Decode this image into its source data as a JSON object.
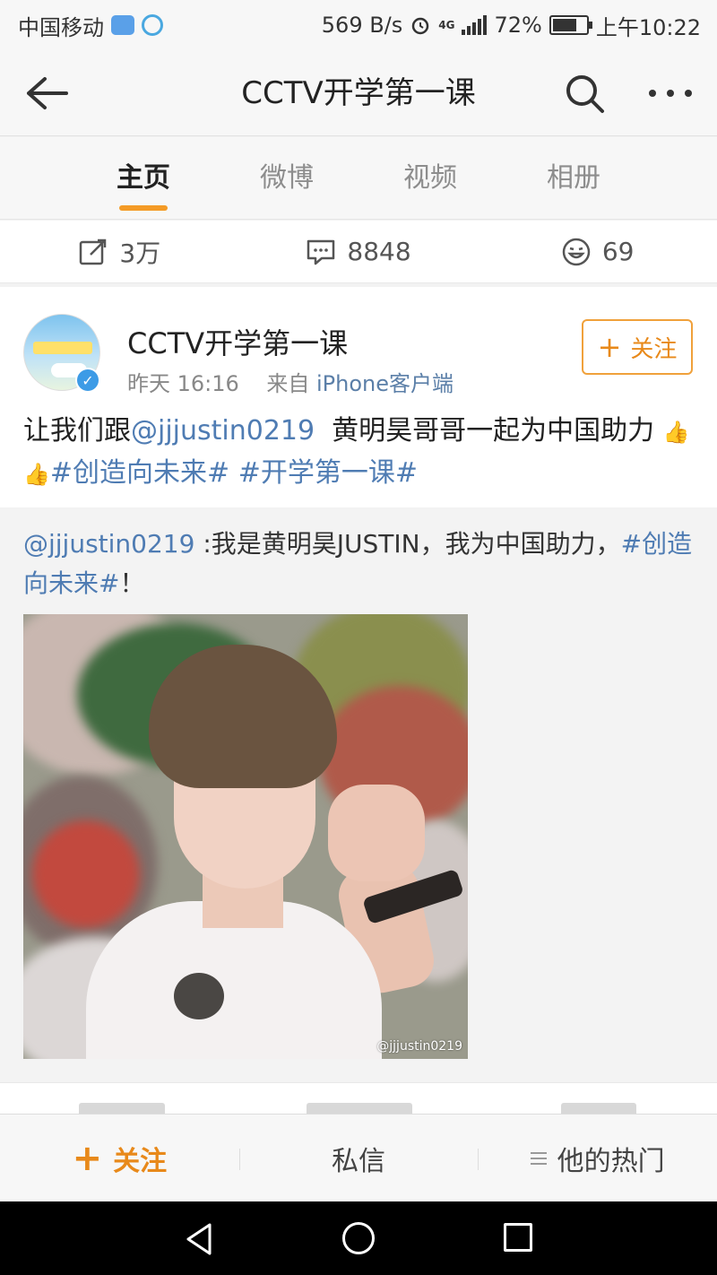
{
  "status_bar": {
    "carrier": "中国移动",
    "net_speed": "569 B/s",
    "network": "4G",
    "battery": "72%",
    "time": "上午10:22"
  },
  "nav": {
    "title": "CCTV开学第一课",
    "icons": [
      "back-arrow-icon",
      "search-icon",
      "more-icon"
    ]
  },
  "tabs": [
    {
      "label": "主页",
      "active": true
    },
    {
      "label": "微博",
      "active": false
    },
    {
      "label": "视频",
      "active": false
    },
    {
      "label": "相册",
      "active": false
    }
  ],
  "stats": {
    "reposts": "3万",
    "comments": "8848",
    "likes": "69"
  },
  "post": {
    "author": "CCTV开学第一课",
    "time": "昨天 16:16",
    "source_prefix": "来自",
    "source": "iPhone客户端",
    "follow_label": "关注",
    "text_prefix": "让我们跟",
    "mention": "@jjjustin0219",
    "text_middle": "  黄明昊哥哥一起为中国助力",
    "tag1": "#创造向未来#",
    "tag2": "#开学第一课#"
  },
  "repost": {
    "mention": "@jjjustin0219",
    "text": " :我是黄明昊JUSTIN，我为中国助力，",
    "tag": "#创造向未来#",
    "suffix": "！",
    "watermark": "@jjjustin0219"
  },
  "bottom_bar": {
    "follow": "关注",
    "message": "私信",
    "hot": "他的热门"
  },
  "colors": {
    "accent_orange": "#f49b26",
    "link_blue": "#4f7cb3",
    "verified_blue": "#3d9be6"
  }
}
